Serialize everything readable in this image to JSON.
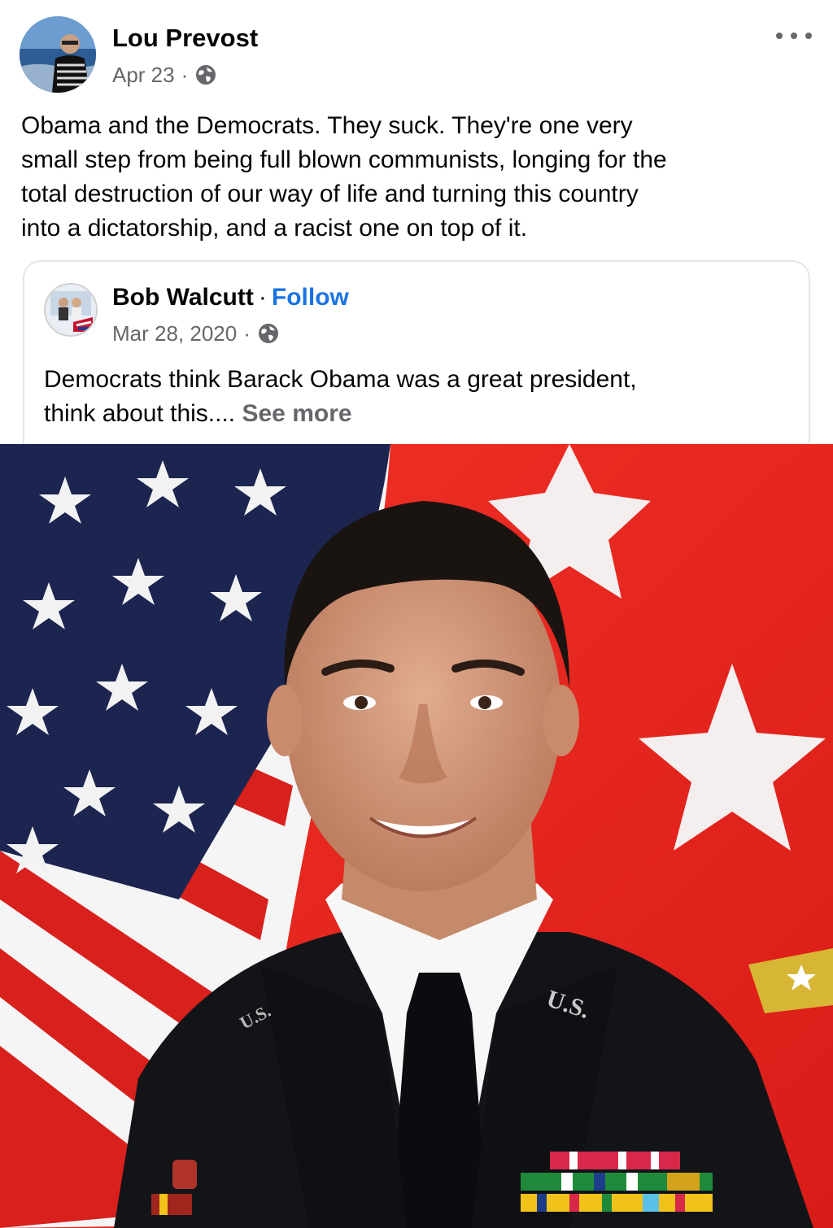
{
  "post": {
    "author": "Lou Prevost",
    "date": "Apr 23",
    "separator": "·",
    "privacy_icon": "globe-icon",
    "more_icon": "more-options-icon",
    "text": "Obama and the Democrats.  They suck. They're one very\nsmall step from being full blown communists, longing for the\ntotal destruction of our way of life and turning this country\ninto a dictatorship, and a racist one on top of it."
  },
  "shared_post": {
    "author": "Bob Walcutt",
    "separator": "·",
    "follow_label": "Follow",
    "date": "Mar 28, 2020",
    "privacy_icon": "globe-icon",
    "text": "Democrats think Barack Obama was a great president,\nthink about this.... ",
    "see_more_label": "See more"
  },
  "photo": {
    "insignia_text": "U.S.",
    "insignia_text_left": "U.S."
  },
  "colors": {
    "link_blue": "#1b74e4",
    "secondary_text": "#65676b",
    "primary_text": "#050505",
    "card_border": "#e4e6eb",
    "flag_red": "#e8261f",
    "flag_blue": "#1c2550"
  }
}
